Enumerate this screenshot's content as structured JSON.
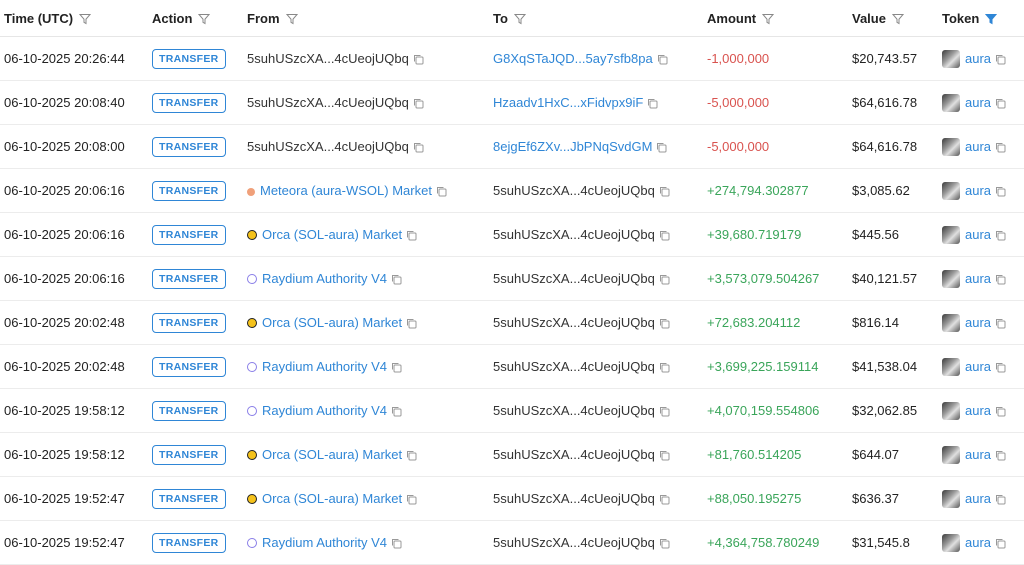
{
  "columns": {
    "time": "Time (UTC)",
    "action": "Action",
    "from": "From",
    "to": "To",
    "amount": "Amount",
    "value": "Value",
    "token": "Token"
  },
  "colors": {
    "link": "#2f86d6",
    "negative": "#d9534f",
    "positive": "#3aa55a"
  },
  "rows": [
    {
      "time": "06-10-2025 20:26:44",
      "action": "TRANSFER",
      "from": "5suhUSzcXA...4cUeojUQbq",
      "from_type": "plain",
      "to": "G8XqSTaJQD...5ay7sfb8pa",
      "to_type": "link",
      "amount": "-1,000,000",
      "amount_sign": "neg",
      "value": "$20,743.57",
      "token": "aura"
    },
    {
      "time": "06-10-2025 20:08:40",
      "action": "TRANSFER",
      "from": "5suhUSzcXA...4cUeojUQbq",
      "from_type": "plain",
      "to": "Hzaadv1HxC...xFidvpx9iF",
      "to_type": "link",
      "amount": "-5,000,000",
      "amount_sign": "neg",
      "value": "$64,616.78",
      "token": "aura"
    },
    {
      "time": "06-10-2025 20:08:00",
      "action": "TRANSFER",
      "from": "5suhUSzcXA...4cUeojUQbq",
      "from_type": "plain",
      "to": "8ejgEf6ZXv...JbPNqSvdGM",
      "to_type": "link",
      "amount": "-5,000,000",
      "amount_sign": "neg",
      "value": "$64,616.78",
      "token": "aura"
    },
    {
      "time": "06-10-2025 20:06:16",
      "action": "TRANSFER",
      "from": "Meteora (aura-WSOL) Market",
      "from_type": "meteora",
      "to": "5suhUSzcXA...4cUeojUQbq",
      "to_type": "plain",
      "amount": "+274,794.302877",
      "amount_sign": "pos",
      "value": "$3,085.62",
      "token": "aura"
    },
    {
      "time": "06-10-2025 20:06:16",
      "action": "TRANSFER",
      "from": "Orca (SOL-aura) Market",
      "from_type": "orca",
      "to": "5suhUSzcXA...4cUeojUQbq",
      "to_type": "plain",
      "amount": "+39,680.719179",
      "amount_sign": "pos",
      "value": "$445.56",
      "token": "aura"
    },
    {
      "time": "06-10-2025 20:06:16",
      "action": "TRANSFER",
      "from": "Raydium Authority V4",
      "from_type": "raydium",
      "to": "5suhUSzcXA...4cUeojUQbq",
      "to_type": "plain",
      "amount": "+3,573,079.504267",
      "amount_sign": "pos",
      "value": "$40,121.57",
      "token": "aura"
    },
    {
      "time": "06-10-2025 20:02:48",
      "action": "TRANSFER",
      "from": "Orca (SOL-aura) Market",
      "from_type": "orca",
      "to": "5suhUSzcXA...4cUeojUQbq",
      "to_type": "plain",
      "amount": "+72,683.204112",
      "amount_sign": "pos",
      "value": "$816.14",
      "token": "aura"
    },
    {
      "time": "06-10-2025 20:02:48",
      "action": "TRANSFER",
      "from": "Raydium Authority V4",
      "from_type": "raydium",
      "to": "5suhUSzcXA...4cUeojUQbq",
      "to_type": "plain",
      "amount": "+3,699,225.159114",
      "amount_sign": "pos",
      "value": "$41,538.04",
      "token": "aura"
    },
    {
      "time": "06-10-2025 19:58:12",
      "action": "TRANSFER",
      "from": "Raydium Authority V4",
      "from_type": "raydium",
      "to": "5suhUSzcXA...4cUeojUQbq",
      "to_type": "plain",
      "amount": "+4,070,159.554806",
      "amount_sign": "pos",
      "value": "$32,062.85",
      "token": "aura"
    },
    {
      "time": "06-10-2025 19:58:12",
      "action": "TRANSFER",
      "from": "Orca (SOL-aura) Market",
      "from_type": "orca",
      "to": "5suhUSzcXA...4cUeojUQbq",
      "to_type": "plain",
      "amount": "+81,760.514205",
      "amount_sign": "pos",
      "value": "$644.07",
      "token": "aura"
    },
    {
      "time": "06-10-2025 19:52:47",
      "action": "TRANSFER",
      "from": "Orca (SOL-aura) Market",
      "from_type": "orca",
      "to": "5suhUSzcXA...4cUeojUQbq",
      "to_type": "plain",
      "amount": "+88,050.195275",
      "amount_sign": "pos",
      "value": "$636.37",
      "token": "aura"
    },
    {
      "time": "06-10-2025 19:52:47",
      "action": "TRANSFER",
      "from": "Raydium Authority V4",
      "from_type": "raydium",
      "to": "5suhUSzcXA...4cUeojUQbq",
      "to_type": "plain",
      "amount": "+4,364,758.780249",
      "amount_sign": "pos",
      "value": "$31,545.8",
      "token": "aura"
    }
  ]
}
